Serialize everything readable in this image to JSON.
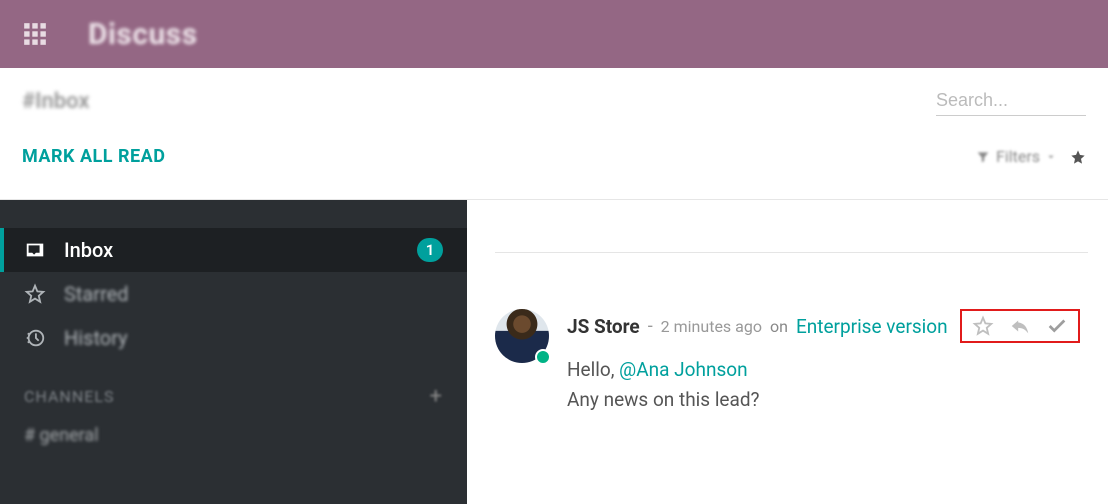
{
  "header": {
    "app_name": "Discuss"
  },
  "subheader": {
    "channel_title": "#Inbox",
    "mark_all_label": "MARK ALL READ",
    "search_placeholder": "Search...",
    "filters_label": "Filters"
  },
  "sidebar": {
    "items": [
      {
        "icon": "inbox-icon",
        "label": "Inbox",
        "badge": "1",
        "active": true
      },
      {
        "icon": "star-icon",
        "label": "Starred"
      },
      {
        "icon": "history-icon",
        "label": "History"
      }
    ],
    "channels_label": "CHANNELS",
    "channels": [
      {
        "label": "# general"
      }
    ]
  },
  "message": {
    "author": "JS Store",
    "time": "2 minutes ago",
    "on": "on",
    "record": "Enterprise version",
    "greeting": "Hello, ",
    "mention": "@Ana Johnson",
    "line2": "Any news on this lead?"
  }
}
